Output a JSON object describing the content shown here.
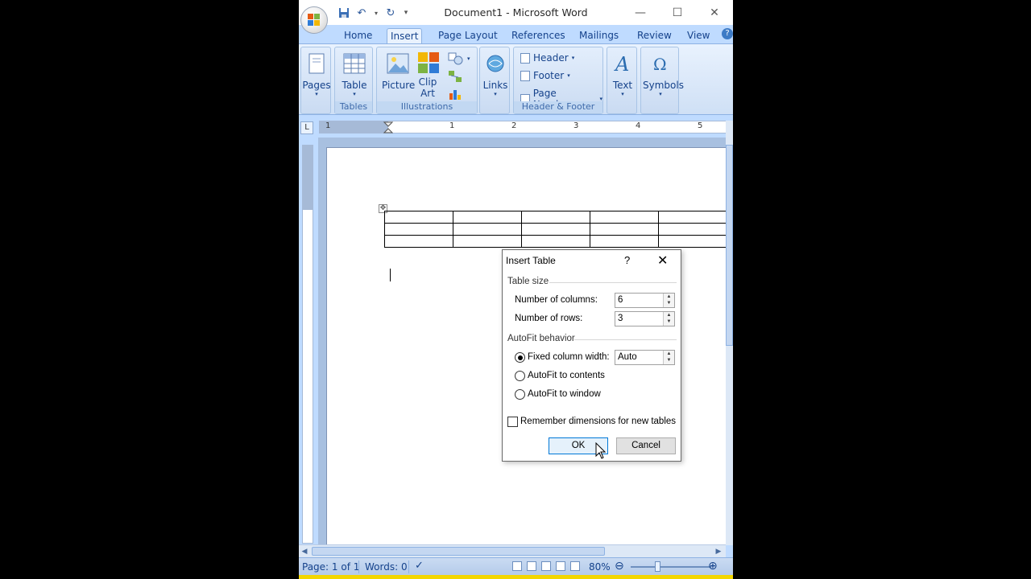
{
  "window": {
    "title": "Document1 - Microsoft Word"
  },
  "tabs": [
    "Home",
    "Insert",
    "Page Layout",
    "References",
    "Mailings",
    "Review",
    "View"
  ],
  "active_tab": "Insert",
  "ribbon": {
    "pages": {
      "label": "Pages"
    },
    "tables": {
      "button": "Table",
      "group": "Tables"
    },
    "illustrations": {
      "picture": "Picture",
      "clip_art_1": "Clip",
      "clip_art_2": "Art",
      "group": "Illustrations"
    },
    "links": {
      "label": "Links"
    },
    "header_footer": {
      "header": "Header",
      "footer": "Footer",
      "page_number": "Page Number",
      "group": "Header & Footer"
    },
    "text": {
      "label": "Text"
    },
    "symbols": {
      "label": "Symbols"
    }
  },
  "ruler": {
    "numbers": [
      "1",
      "1",
      "2",
      "3",
      "4",
      "5"
    ]
  },
  "document": {
    "table_columns": 5,
    "table_rows": 3
  },
  "dialog": {
    "title": "Insert Table",
    "help": "?",
    "table_size_heading": "Table size",
    "columns_label": "Number of columns:",
    "columns_value": "6",
    "rows_label": "Number of rows:",
    "rows_value": "3",
    "autofit_heading": "AutoFit behavior",
    "fixed_label": "Fixed column width:",
    "fixed_value": "Auto",
    "autofit_contents_label": "AutoFit to contents",
    "autofit_window_label": "AutoFit to window",
    "remember_label": "Remember dimensions for new tables",
    "selected_option": "fixed",
    "ok": "OK",
    "cancel": "Cancel"
  },
  "statusbar": {
    "page": "Page: 1 of 1",
    "words": "Words: 0",
    "zoom": "80%"
  }
}
